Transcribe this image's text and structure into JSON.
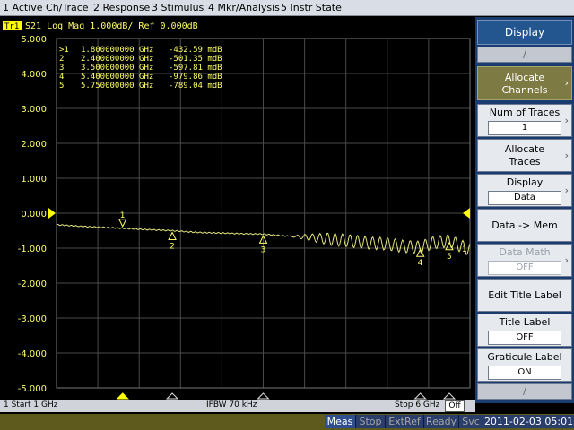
{
  "menu": [
    "1 Active Ch/Trace",
    "2 Response",
    "3 Stimulus",
    "4 Mkr/Analysis",
    "5 Instr State"
  ],
  "trace": {
    "badge": "Tr1",
    "header": "S21 Log Mag 1.000dB/ Ref 0.000dB",
    "color": "#e6e67e",
    "ref_marker_color": "#ffff00"
  },
  "chart_data": {
    "type": "line",
    "x_unit": "GHz",
    "y_unit": "dB",
    "xlim": [
      1,
      6
    ],
    "ylim": [
      -5,
      5
    ],
    "yticks": [
      "5.000",
      "4.000",
      "3.000",
      "2.000",
      "1.000",
      "0.000",
      "-1.000",
      "-2.000",
      "-3.000",
      "-4.000",
      "-5.000"
    ],
    "grid": true,
    "series": [
      {
        "x": [
          1.0,
          1.25,
          1.5,
          1.8,
          2.1,
          2.4,
          2.7,
          3.0,
          3.25,
          3.5,
          3.75,
          4.0,
          4.25,
          4.5,
          4.75,
          5.0,
          5.2,
          5.4,
          5.55,
          5.75,
          5.9,
          6.0
        ],
        "y": [
          -0.33,
          -0.37,
          -0.4,
          -0.43,
          -0.47,
          -0.5,
          -0.55,
          -0.57,
          -0.59,
          -0.6,
          -0.65,
          -0.68,
          -0.73,
          -0.78,
          -0.85,
          -0.88,
          -0.95,
          -0.98,
          -0.85,
          -0.79,
          -0.95,
          -1.05
        ],
        "ripple_start_ghz": 3.8,
        "ripple_amp_db": 0.18,
        "ripple_cycles_per_ghz": 11
      }
    ],
    "markers": [
      {
        "id": "1",
        "x": 1.8,
        "y": -0.43,
        "active": true
      },
      {
        "id": "2",
        "x": 2.4,
        "y": -0.5,
        "active": false
      },
      {
        "id": "3",
        "x": 3.5,
        "y": -0.6,
        "active": false
      },
      {
        "id": "4",
        "x": 5.4,
        "y": -0.98,
        "active": false
      },
      {
        "id": "5",
        "x": 5.75,
        "y": -0.79,
        "active": false
      }
    ],
    "marker_table": [
      {
        "prefix": ">1",
        "freq": "1.800000000 GHz",
        "value": "-432.59 mdB"
      },
      {
        "prefix": " 2",
        "freq": "2.400000000 GHz",
        "value": "-501.35 mdB"
      },
      {
        "prefix": " 3",
        "freq": "3.500000000 GHz",
        "value": "-597.81 mdB"
      },
      {
        "prefix": " 4",
        "freq": "5.400000000 GHz",
        "value": "-979.86 mdB"
      },
      {
        "prefix": " 5",
        "freq": "5.750000000 GHz",
        "value": "-789.04 mdB"
      }
    ],
    "trace_end_label": "1"
  },
  "channel_bar": {
    "start": "1  Start 1 GHz",
    "ifbw": "IFBW 70 kHz",
    "stop": "Stop 6 GHz",
    "off": "Off"
  },
  "softkeys": {
    "display": "Display",
    "up_arrow": "∕",
    "allocate_channels": [
      "Allocate",
      "Channels"
    ],
    "num_traces": {
      "label": "Num of Traces",
      "value": "1"
    },
    "allocate_traces": [
      "Allocate",
      "Traces"
    ],
    "display_mode": {
      "label": "Display",
      "value": "Data"
    },
    "data_to_mem": "Data -> Mem",
    "data_math": {
      "label": "Data Math",
      "value": "OFF"
    },
    "edit_title_label": "Edit Title Label",
    "title_label": {
      "label": "Title Label",
      "value": "OFF"
    },
    "graticule_label": {
      "label": "Graticule Label",
      "value": "ON"
    },
    "down_arrow": "∕",
    "chevron": "›"
  },
  "status": {
    "meas": "Meas",
    "stop": "Stop",
    "extref": "ExtRef",
    "ready": "Ready",
    "svc": "Svc",
    "datetime": "2011-02-03 05:01"
  }
}
